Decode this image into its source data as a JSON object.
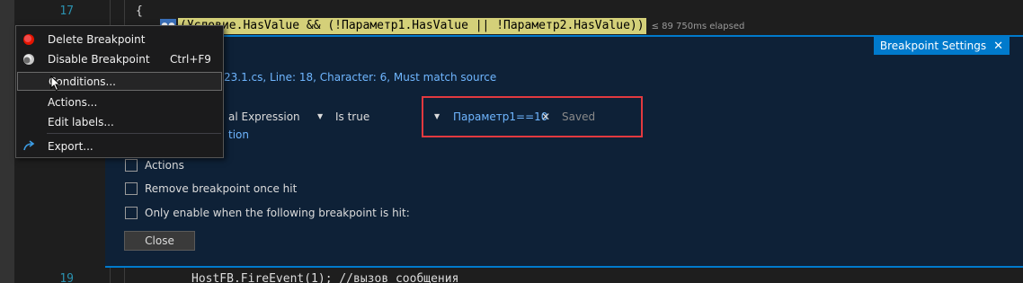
{
  "editor": {
    "line_numbers": [
      "17",
      "19"
    ],
    "code_brace": "{",
    "condition_code": "(Условие.HasValue && (!Параметр1.HasValue || !Параметр2.HasValue))",
    "perf_tip": "≤ 89 750ms elapsed",
    "bottom_code": "HostFB.FireEvent(1); //вызов сообщения"
  },
  "context_menu": {
    "items": [
      {
        "label": "Delete Breakpoint",
        "shortcut": "",
        "icon": "breakpoint-red-icon"
      },
      {
        "label": "Disable Breakpoint",
        "shortcut": "Ctrl+F9",
        "icon": "breakpoint-disable-icon"
      },
      {
        "label": "Conditions...",
        "shortcut": "",
        "icon": ""
      },
      {
        "label": "Actions...",
        "shortcut": "",
        "icon": ""
      },
      {
        "label": "Edit labels...",
        "shortcut": "",
        "icon": ""
      },
      {
        "label": "Export...",
        "shortcut": "",
        "icon": "export-arrow-icon"
      }
    ]
  },
  "breakpoint_settings": {
    "title": "Breakpoint Settings",
    "location": "23.1.cs, Line: 18, Character: 6, Must match source",
    "condition_type": "al Expression",
    "condition_operator": "Is true",
    "condition_value": "Параметр1==10",
    "saved_label": "Saved",
    "add_condition": "tion",
    "checkboxes": [
      {
        "label": "Actions",
        "checked": false
      },
      {
        "label": "Remove breakpoint once hit",
        "checked": false
      },
      {
        "label": "Only enable when the following breakpoint is hit:",
        "checked": false
      }
    ],
    "close_label": "Close"
  },
  "colors": {
    "accent": "#007acc",
    "highlight_box": "#e2393f",
    "link": "#6fb6ff",
    "condition_highlight": "#d4d079"
  }
}
